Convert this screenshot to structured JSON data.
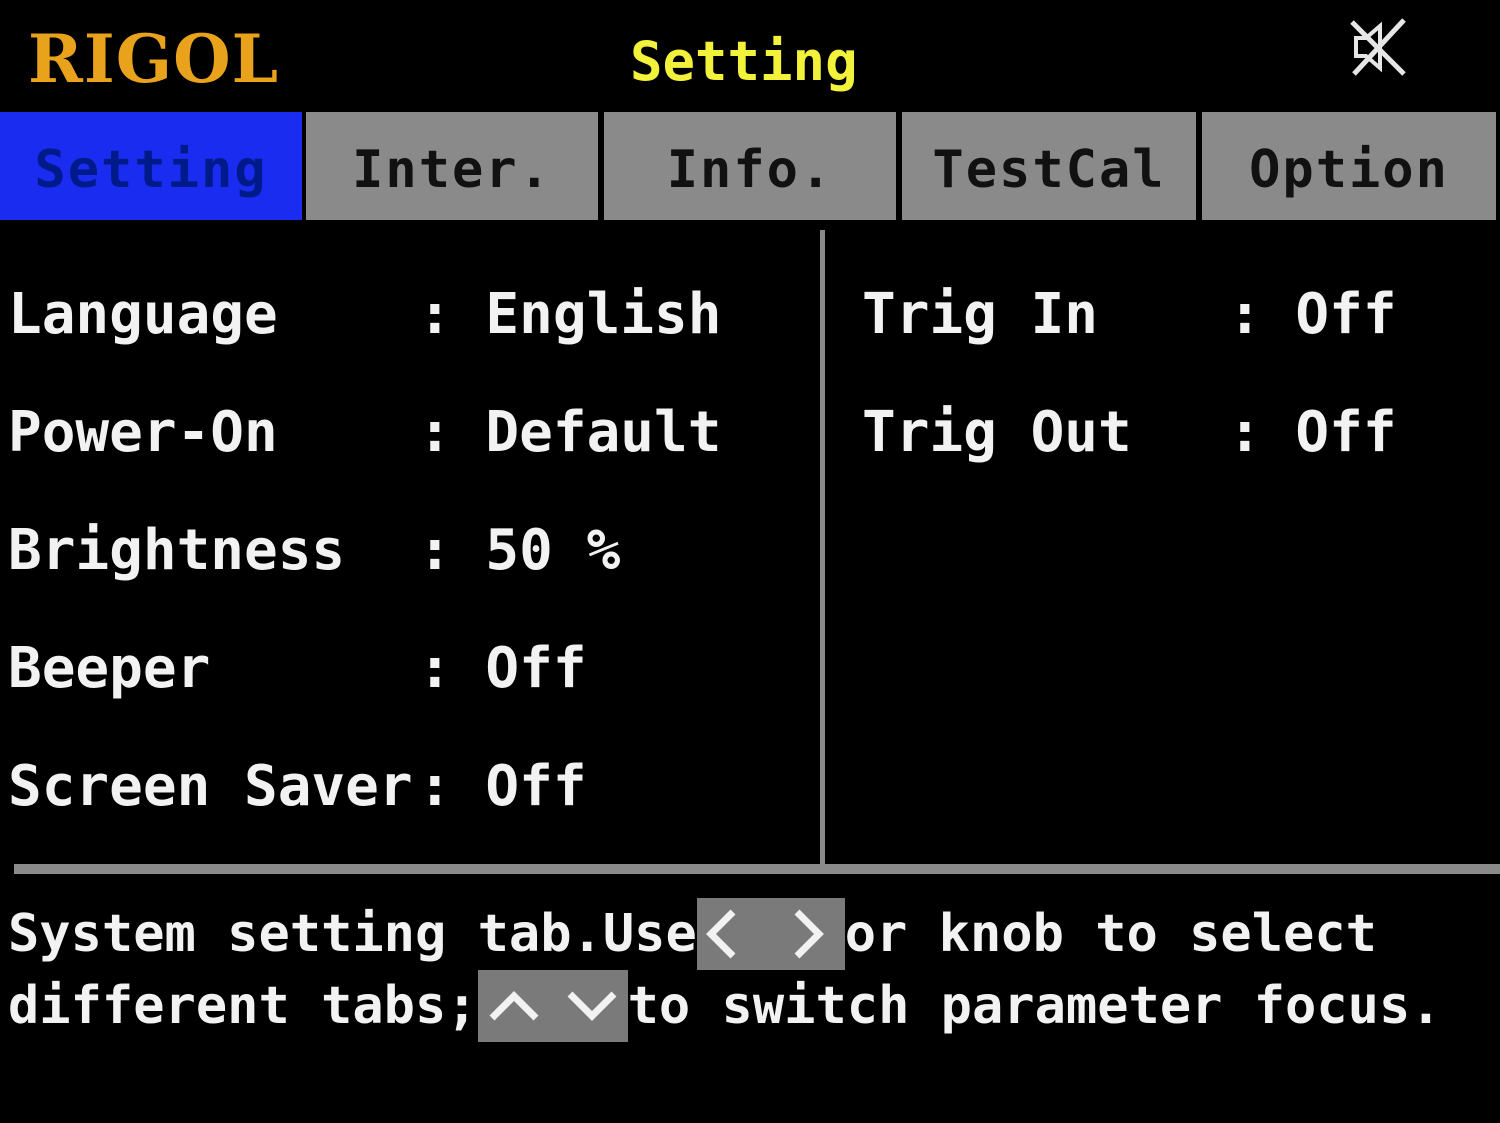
{
  "header": {
    "logo": "RIGOL",
    "title": "Setting",
    "status_icon": "mute-icon"
  },
  "tabs": [
    {
      "label": "Setting",
      "active": true
    },
    {
      "label": "Inter.",
      "active": false
    },
    {
      "label": "Info.",
      "active": false
    },
    {
      "label": "TestCal",
      "active": false
    },
    {
      "label": "Option",
      "active": false
    }
  ],
  "left_params": [
    {
      "label": "Language",
      "value": ": English"
    },
    {
      "label": "Power-On",
      "value": ": Default"
    },
    {
      "label": "Brightness",
      "value": ": 50 %"
    },
    {
      "label": "Beeper",
      "value": ": Off"
    },
    {
      "label": "Screen Saver",
      "value": ": Off"
    }
  ],
  "right_params": [
    {
      "label": "Trig In",
      "value": ": Off"
    },
    {
      "label": "Trig Out",
      "value": ": Off"
    }
  ],
  "help": {
    "line1_pre": "System setting tab.Use",
    "line1_keys": "left-right-arrow-keys-icon",
    "line1_post": "or knob to select",
    "line2_pre": "different tabs;",
    "line2_keys": "up-down-arrow-keys-icon",
    "line2_post": "to switch parameter focus."
  },
  "colors": {
    "logo": "#e8a21c",
    "title": "#f2f23a",
    "active_tab_bg": "#1a2cf0",
    "tab_bg": "#8a8a8a",
    "text": "#f2f2f2",
    "background": "#000000"
  }
}
